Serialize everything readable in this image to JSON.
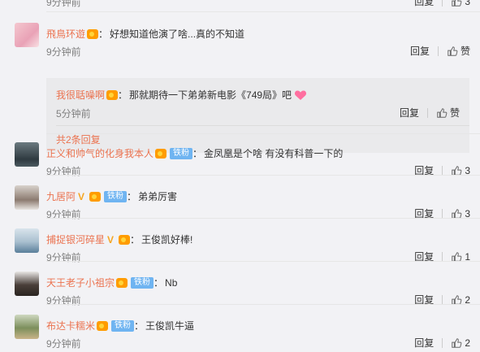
{
  "top_partial": {
    "time": "9分钟前",
    "reply_label": "回复",
    "like_count": "3"
  },
  "comments": [
    {
      "username": "飛鳥环遊",
      "text": "好想知道他演了啥...真的不知道",
      "time": "9分钟前",
      "reply_label": "回复",
      "like_label": "赞",
      "sub_reply": {
        "username": "我很聒噪啊",
        "text": "那就期待一下弟弟新电影《749局》吧",
        "time": "5分钟前",
        "reply_label": "回复",
        "like_label": "赞",
        "more_label": "共2条回复"
      }
    },
    {
      "username": "正义和帅气的化身我本人",
      "fan_badge": "铁粉",
      "text": "金凤凰是个啥 有没有科普一下的",
      "time": "9分钟前",
      "reply_label": "回复",
      "like_count": "3"
    },
    {
      "username": "九居阿",
      "fan_badge": "铁粉",
      "text": "弟弟厉害",
      "time": "9分钟前",
      "reply_label": "回复",
      "like_count": "3"
    },
    {
      "username": "捕捉银河碎星",
      "text": "王俊凯好棒!",
      "time": "9分钟前",
      "reply_label": "回复",
      "like_count": "1"
    },
    {
      "username": "天王老子小祖宗",
      "fan_badge": "铁粉",
      "text": "Nb",
      "time": "9分钟前",
      "reply_label": "回复",
      "like_count": "2"
    },
    {
      "username": "布达卡糯米",
      "fan_badge": "铁粉",
      "text": "王俊凯牛逼",
      "time": "9分钟前",
      "reply_label": "回复",
      "like_count": "2"
    }
  ],
  "colors": {
    "username": "#eb7350",
    "fan_badge": "#6fb4f1",
    "background": "#f2f2f5"
  },
  "icons": [
    "thumb-up-icon",
    "verified-v-icon",
    "vip-crown-icon",
    "heart-icon"
  ]
}
